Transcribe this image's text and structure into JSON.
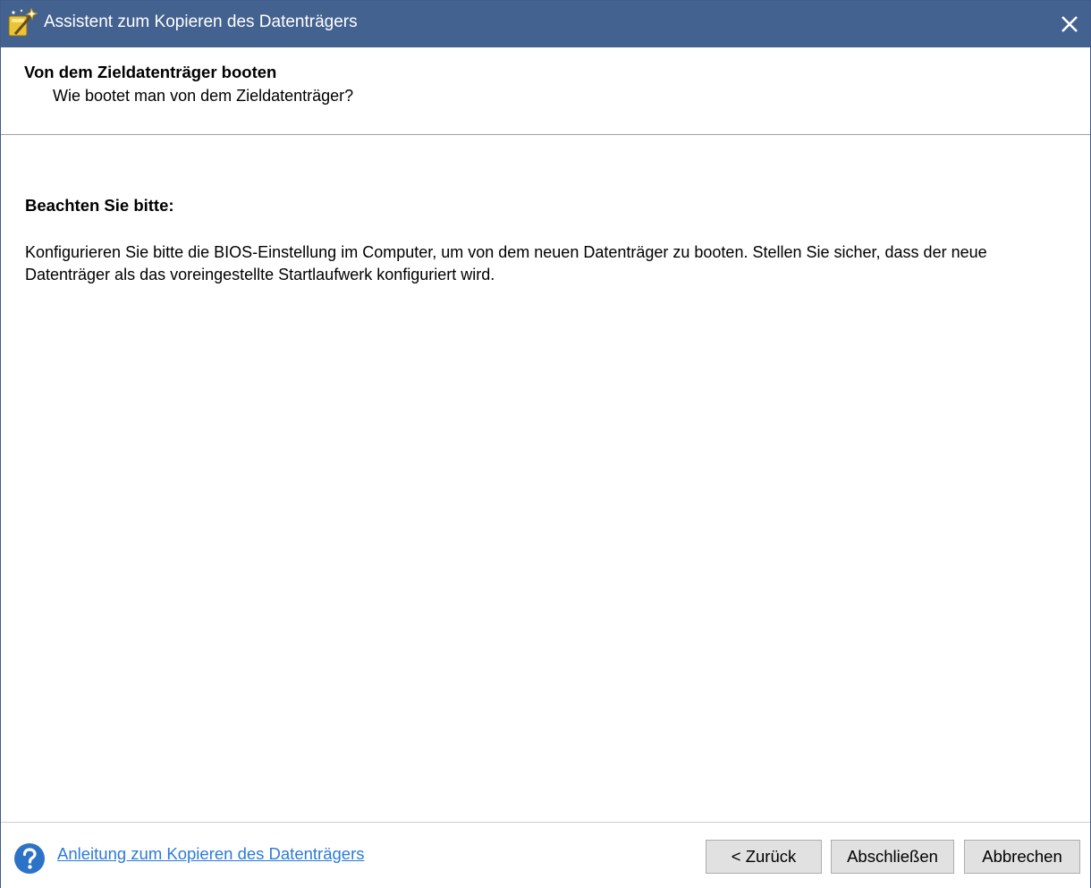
{
  "window": {
    "title": "Assistent zum Kopieren des Datenträgers",
    "app_icon": "wizard-icon",
    "close_icon": "close-icon"
  },
  "header": {
    "title": "Von dem Zieldatenträger booten",
    "subtitle": "Wie bootet man von dem Zieldatenträger?"
  },
  "content": {
    "note_title": "Beachten Sie bitte:",
    "note_body": "Konfigurieren Sie bitte die BIOS-Einstellung im Computer, um von dem neuen Datenträger zu booten. Stellen Sie sicher, dass der neue Datenträger als das voreingestellte Startlaufwerk konfiguriert wird."
  },
  "footer": {
    "help_icon": "question-circle-icon",
    "help_link": "Anleitung zum Kopieren des Datenträgers",
    "back_label": "< Zurück",
    "finish_label": "Abschließen",
    "cancel_label": "Abbrechen"
  },
  "colors": {
    "titlebar": "#44628f",
    "link": "#2b7bd6",
    "help_icon": "#2c73c7"
  }
}
